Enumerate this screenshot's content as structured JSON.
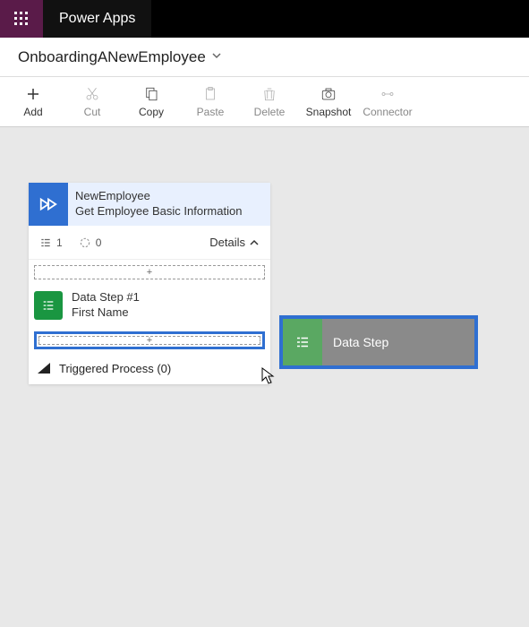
{
  "header": {
    "app_title": "Power Apps"
  },
  "subheader": {
    "flow_name": "OnboardingANewEmployee"
  },
  "toolbar": {
    "add": "Add",
    "cut": "Cut",
    "copy": "Copy",
    "paste": "Paste",
    "delete": "Delete",
    "snapshot": "Snapshot",
    "connector": "Connector"
  },
  "card": {
    "title": "NewEmployee",
    "subtitle": "Get Employee Basic Information",
    "count_steps": "1",
    "count_pending": "0",
    "details_label": "Details",
    "slot_plus": "+",
    "step1_title": "Data Step #1",
    "step1_sub": "First Name",
    "triggered_label": "Triggered Process (0)"
  },
  "drag": {
    "label": "Data Step"
  }
}
